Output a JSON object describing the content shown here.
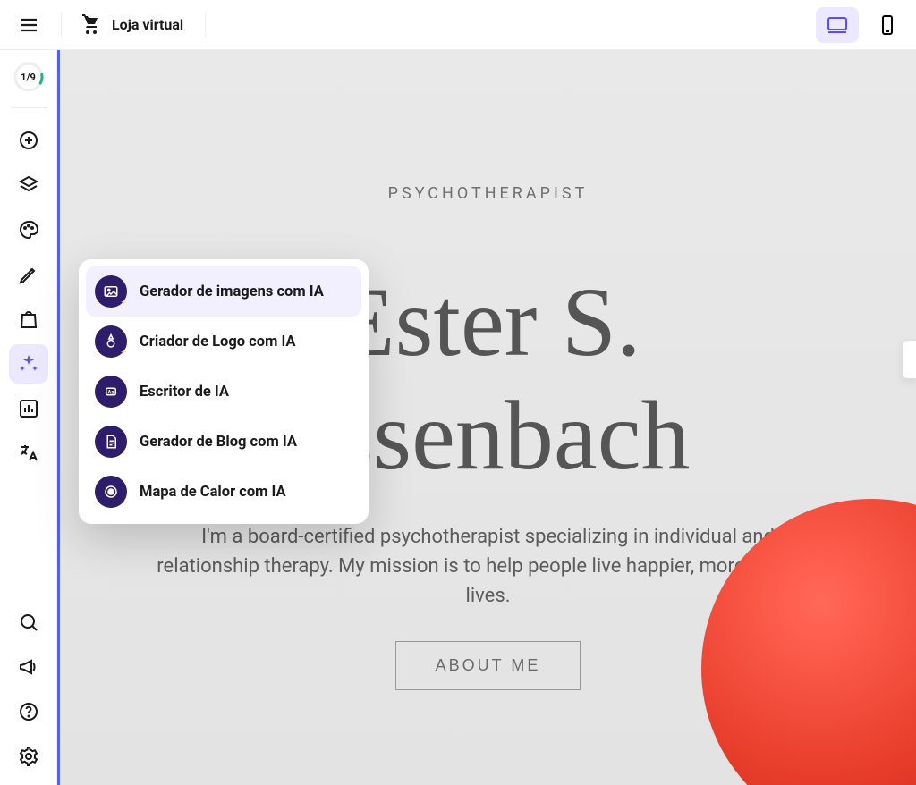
{
  "topbar": {
    "brand_label": "Loja virtual"
  },
  "sidebar": {
    "progress_label": "1/9"
  },
  "ai_menu": {
    "items": [
      {
        "label": "Gerador de imagens com IA"
      },
      {
        "label": "Criador de Logo com IA"
      },
      {
        "label": "Escritor de IA"
      },
      {
        "label": "Gerador de Blog com IA"
      },
      {
        "label": "Mapa de Calor com IA"
      }
    ]
  },
  "hero": {
    "eyebrow": "PSYCHOTHERAPIST",
    "name_line1": "Ester S.",
    "name_line2": "ossenbach",
    "description": "I'm a board-certified psychotherapist specializing in individual and relationship therapy. My mission is to help people live happier, more fulfilling lives.",
    "cta_label": "ABOUT ME"
  }
}
